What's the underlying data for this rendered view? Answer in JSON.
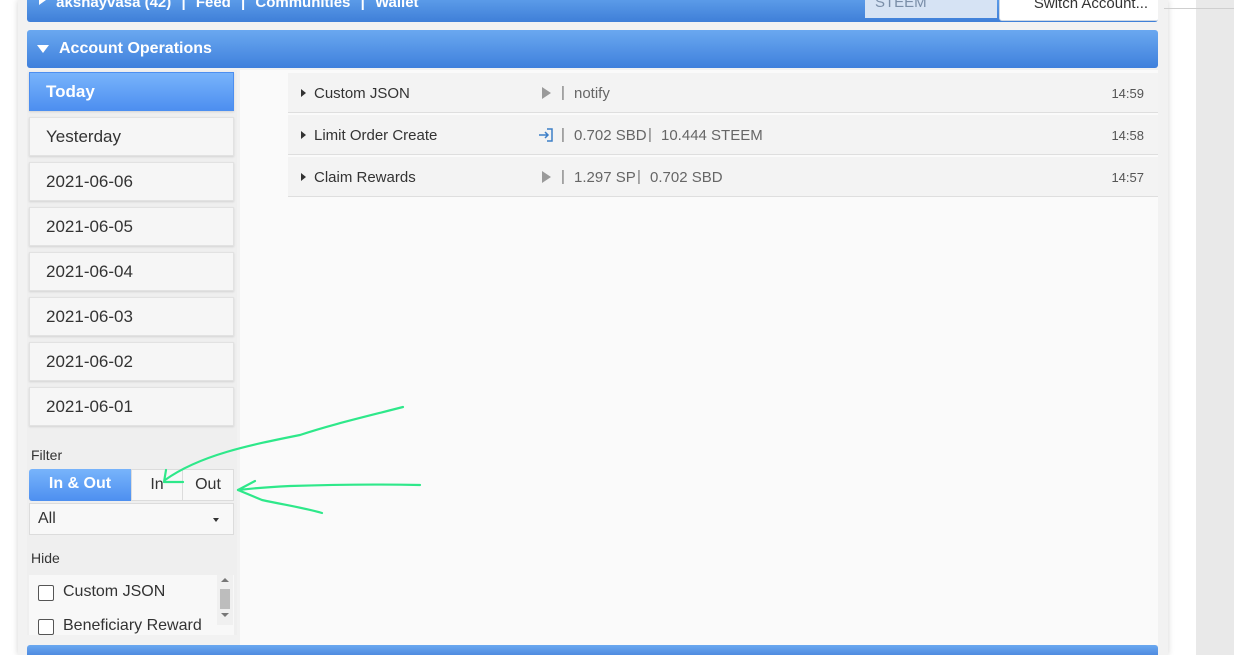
{
  "topbar": {
    "items": [
      "akshayvasa (42)",
      "|",
      "Feed",
      "|",
      "Communities",
      "|",
      "Wallet"
    ],
    "coin": "STEEM",
    "switch_account": "Switch Account..."
  },
  "account_ops": {
    "title": "Account Operations"
  },
  "dates": [
    "Today",
    "Yesterday",
    "2021-06-06",
    "2021-06-05",
    "2021-06-04",
    "2021-06-03",
    "2021-06-02",
    "2021-06-01"
  ],
  "filter": {
    "label": "Filter",
    "options": [
      "In & Out",
      "In",
      "Out"
    ],
    "select_value": "All"
  },
  "hide": {
    "label": "Hide",
    "items": [
      "Custom JSON",
      "Beneficiary Reward"
    ]
  },
  "operations": [
    {
      "name": "Custom JSON",
      "icon": "play-icon",
      "details": [
        "notify"
      ],
      "time": "14:59"
    },
    {
      "name": "Limit Order Create",
      "icon": "sign-in-icon",
      "details": [
        "0.702 SBD",
        "10.444 STEEM"
      ],
      "time": "14:58"
    },
    {
      "name": "Claim Rewards",
      "icon": "play-icon",
      "details": [
        "1.297 SP",
        "0.702 SBD"
      ],
      "time": "14:57"
    }
  ],
  "colors": {
    "accent": "#4d8ff0",
    "annotation": "#2ee88a"
  }
}
